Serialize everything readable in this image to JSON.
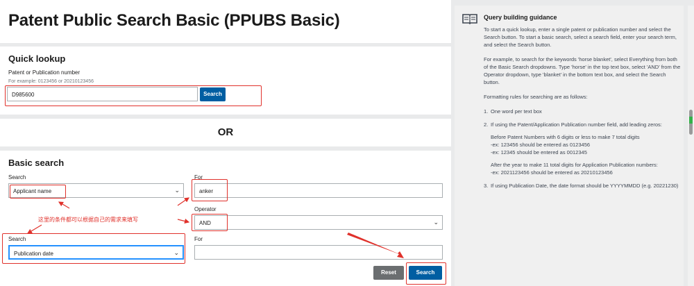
{
  "title": "Patent Public Search Basic (PPUBS Basic)",
  "quick_lookup": {
    "heading": "Quick lookup",
    "label": "Patent or Publication number",
    "example": "For example: 0123456 or 20210123456",
    "value": "D985600",
    "search_label": "Search"
  },
  "or_text": "OR",
  "basic_search": {
    "heading": "Basic search",
    "search1_label": "Search",
    "search1_value": "Applicant name",
    "for1_label": "For",
    "for1_value": "anker",
    "operator_label": "Operator",
    "operator_value": "AND",
    "search2_label": "Search",
    "search2_value": "Publication date",
    "for2_label": "For",
    "for2_value": "",
    "reset_label": "Reset",
    "search_label": "Search"
  },
  "annotation": "这里的条件都可以根据自己的需求来填写",
  "guidance": {
    "title": "Query building guidance",
    "p1": "To start a quick lookup, enter a single patent or publication number and select the Search button. To start a basic search, select a search field, enter your search term, and select the Search button.",
    "p2": "For example, to search for the keywords 'horse blanket', select Everything from both of the Basic Search dropdowns. Type 'horse' in the top text box, select 'AND' from the Operator dropdown, type 'blanket' in the bottom text box, and select the Search button.",
    "p3": "Formatting rules for searching are as follows:",
    "rules": [
      {
        "num": "1.",
        "text": "One word per text box"
      },
      {
        "num": "2.",
        "text": "If using the Patent/Application Publication number field, add leading zeros:"
      },
      {
        "num": "3.",
        "text": "If using Publication Date, the date format should be YYYYMMDD (e.g. 20221230)"
      }
    ],
    "rule2_sub1": "Before Patent Numbers with 6 digits or less to make 7 total digits",
    "rule2_sub1_ex1": "-ex: 123456 should be entered as 0123456",
    "rule2_sub1_ex2": "-ex: 12345 should be entered as 0012345",
    "rule2_sub2": "After the year to make 11 total digits for Application Publication numbers:",
    "rule2_sub2_ex1": "-ex: 2021123456 should be entered as 20210123456"
  },
  "colors": {
    "primary_button": "#005ea2",
    "reset_button": "#6b6e70",
    "annotation_red": "#e0312b",
    "focus_blue": "#2491ff"
  }
}
